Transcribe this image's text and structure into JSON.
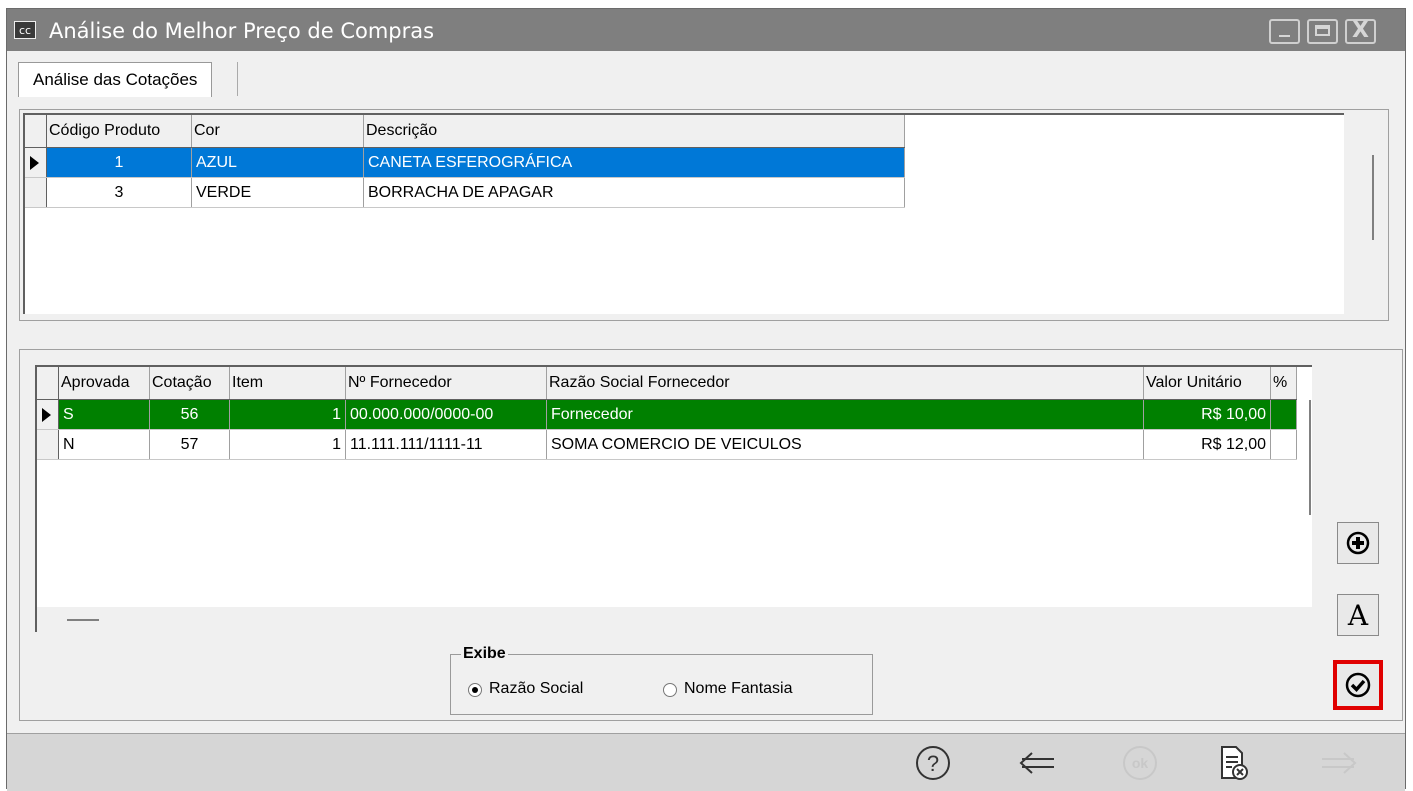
{
  "window": {
    "app_icon_text": "cc",
    "title": "Análise do Melhor Preço de Compras",
    "close_glyph": "X"
  },
  "tab": {
    "label": "Análise das Cotações"
  },
  "products_grid": {
    "columns": [
      "Código Produto",
      "Cor",
      "Descrição"
    ],
    "rows": [
      {
        "codigo": "1",
        "cor": "AZUL",
        "descricao": "CANETA ESFEROGRÁFICA",
        "selected": true
      },
      {
        "codigo": "3",
        "cor": "VERDE",
        "descricao": "BORRACHA DE APAGAR",
        "selected": false
      }
    ]
  },
  "quotes_grid": {
    "columns": [
      "Aprovada",
      "Cotação",
      "Item",
      "Nº Fornecedor",
      "Razão Social Fornecedor",
      "Valor Unitário",
      "%"
    ],
    "rows": [
      {
        "aprovada": "S",
        "cotacao": "56",
        "item": "1",
        "fornecedor": "00.000.000/0000-00",
        "razao": "Fornecedor",
        "valor": "R$ 10,00",
        "selected": true
      },
      {
        "aprovada": "N",
        "cotacao": "57",
        "item": "1",
        "fornecedor": "11.111.111/1111-11",
        "razao": "SOMA COMERCIO DE VEICULOS",
        "valor": "R$ 12,00",
        "selected": false
      }
    ],
    "selected_color": "#008000"
  },
  "side_buttons": {
    "font_button_label": "A"
  },
  "exibe": {
    "legend": "Exibe",
    "options": [
      "Razão Social",
      "Nome Fantasia"
    ],
    "selected": "Razão Social"
  },
  "highlight_color": "#e00000",
  "selection_color": "#0078d7",
  "footer_icons": [
    "help-icon",
    "back-arrow-icon",
    "ok-icon",
    "cancel-document-icon",
    "forward-arrow-icon"
  ]
}
